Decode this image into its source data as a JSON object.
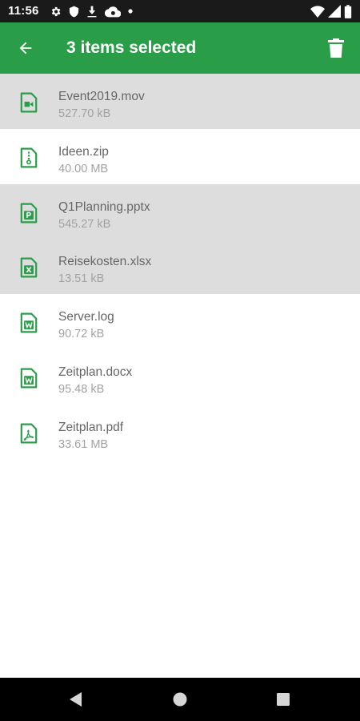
{
  "status_bar": {
    "time": "11:56",
    "icons_left": [
      "gear-icon",
      "shield-icon",
      "download-icon",
      "cloud-sync-icon",
      "dot-icon"
    ],
    "icons_right": [
      "wifi-icon",
      "signal-icon",
      "battery-icon"
    ]
  },
  "app_bar": {
    "title": "3 items selected",
    "back_icon": "arrow-left-icon",
    "delete_icon": "trash-icon",
    "color": "#2a9d48"
  },
  "files": [
    {
      "name": "Event2019.mov",
      "size": "527.70 kB",
      "selected": true,
      "icon": "video-file-icon"
    },
    {
      "name": "Ideen.zip",
      "size": "40.00 MB",
      "selected": false,
      "icon": "zip-file-icon"
    },
    {
      "name": "Q1Planning.pptx",
      "size": "545.27 kB",
      "selected": true,
      "icon": "powerpoint-file-icon"
    },
    {
      "name": "Reisekosten.xlsx",
      "size": "13.51 kB",
      "selected": true,
      "icon": "excel-file-icon"
    },
    {
      "name": "Server.log",
      "size": "90.72 kB",
      "selected": false,
      "icon": "word-file-icon"
    },
    {
      "name": "Zeitplan.docx",
      "size": "95.48 kB",
      "selected": false,
      "icon": "word-file-icon"
    },
    {
      "name": "Zeitplan.pdf",
      "size": "33.61 MB",
      "selected": false,
      "icon": "pdf-file-icon"
    }
  ],
  "colors": {
    "accent": "#2a9d48",
    "selected_row": "#dddddd",
    "file_name": "#666666",
    "file_size": "#a2a2a2"
  },
  "nav_bar": {
    "icons": [
      "back-triangle-icon",
      "home-circle-icon",
      "recents-square-icon"
    ]
  }
}
